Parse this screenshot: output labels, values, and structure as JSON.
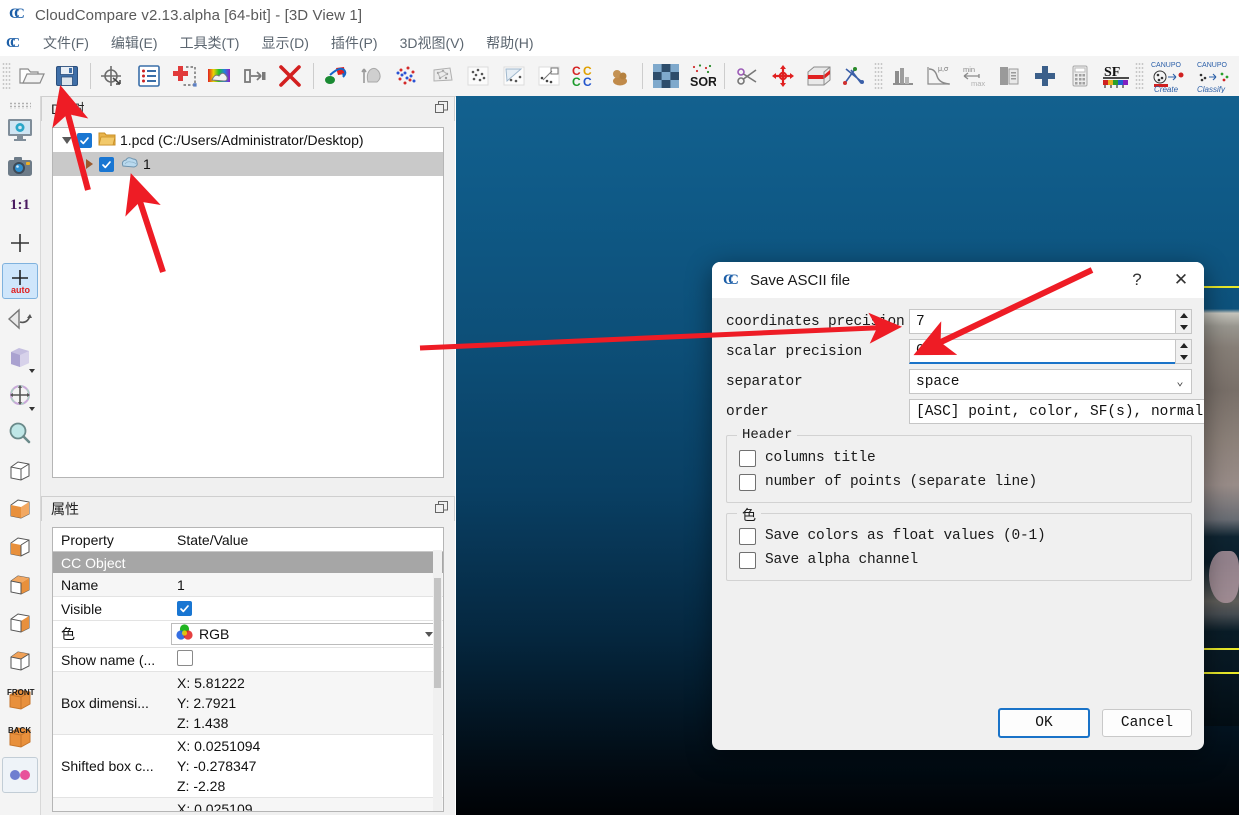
{
  "window": {
    "title": "CloudCompare v2.13.alpha [64-bit] - [3D View 1]",
    "app_icon": "cloudcompare-logo-icon"
  },
  "menubar": {
    "items": [
      {
        "label": "文件(F)",
        "name": "menu-file"
      },
      {
        "label": "编辑(E)",
        "name": "menu-edit"
      },
      {
        "label": "工具类(T)",
        "name": "menu-tools"
      },
      {
        "label": "显示(D)",
        "name": "menu-display"
      },
      {
        "label": "插件(P)",
        "name": "menu-plugins"
      },
      {
        "label": "3D视图(V)",
        "name": "menu-3dview"
      },
      {
        "label": "帮助(H)",
        "name": "menu-help"
      }
    ]
  },
  "toolbar": {
    "buttons": [
      {
        "icon": "open-folder-icon",
        "tip": "Open"
      },
      {
        "icon": "save-floppy-icon",
        "tip": "Save"
      },
      {
        "icon": "global-shift-icon",
        "tip": "Global shift settings"
      },
      {
        "icon": "properties-list-icon",
        "tip": "Toggle properties"
      },
      {
        "icon": "add-point-icon",
        "tip": "Clone"
      },
      {
        "icon": "colors-rainbow-icon",
        "tip": "Colors"
      },
      {
        "icon": "merge-icon",
        "tip": "Merge"
      },
      {
        "icon": "delete-cross-icon",
        "tip": "Delete"
      },
      {
        "icon": "registration-icon",
        "tip": "Register"
      },
      {
        "icon": "segment-gray-icon",
        "tip": "Segment"
      },
      {
        "icon": "sample-points-icon",
        "tip": "Sample points"
      },
      {
        "icon": "mesh-gray-icon",
        "tip": "Mesh"
      },
      {
        "icon": "scatter-gray-icon",
        "tip": "Compute cloud/cloud distance"
      },
      {
        "icon": "cloud-mesh-dist-icon",
        "tip": "Compute cloud/mesh distance"
      },
      {
        "icon": "cloud-prim-dist-icon",
        "tip": "Compute cloud/primitive distance"
      },
      {
        "icon": "cc-compare-icon",
        "tip": "Cloud/cloud compare"
      },
      {
        "icon": "statistical-test-icon",
        "tip": "Statistical test"
      },
      {
        "icon": "subsample-icon",
        "tip": "Subsample"
      },
      {
        "icon": "sor-filter-icon",
        "tip": "SOR filter"
      },
      {
        "icon": "scissors-icon",
        "tip": "Segment"
      },
      {
        "icon": "translate-rotate-icon",
        "tip": "Translate/Rotate"
      },
      {
        "icon": "cross-section-icon",
        "tip": "Cross section"
      },
      {
        "icon": "point-pair-align-icon",
        "tip": "Point pair based alignment"
      },
      {
        "icon": "histogram-icon",
        "tip": "Histogram"
      },
      {
        "icon": "gaussian-icon",
        "tip": "Compute stat. params"
      },
      {
        "icon": "minmax-icon",
        "tip": "SF min/max"
      },
      {
        "icon": "sf-delete-icon",
        "tip": "Delete scalar field"
      },
      {
        "icon": "sf-add-icon",
        "tip": "Add scalar field"
      },
      {
        "icon": "calculator-icon",
        "tip": "SF arithmetic"
      },
      {
        "icon": "sf-colorscale-icon",
        "tip": "Edit color scale"
      },
      {
        "icon": "canupo-create-icon",
        "label1": "CANUPO",
        "label2": "Create"
      },
      {
        "icon": "canupo-classify-icon",
        "label1": "CANUPO",
        "label2": "Classify"
      }
    ]
  },
  "left_toolbar": {
    "buttons": [
      {
        "icon": "display-settings-icon",
        "name": "lt-display-settings"
      },
      {
        "icon": "camera-snapshot-icon",
        "name": "lt-snapshot"
      },
      {
        "icon": "zoom-one-to-one-icon",
        "label": "1:1",
        "name": "lt-zoom-1-1"
      },
      {
        "icon": "pivot-center-icon",
        "name": "lt-set-pivot"
      },
      {
        "icon": "pivot-auto-icon",
        "label": "auto",
        "name": "lt-auto-pivot",
        "selected": true
      },
      {
        "icon": "viewport-rotate-icon",
        "name": "lt-rotate-viewport"
      },
      {
        "icon": "cube-shade-icon",
        "name": "lt-default-views",
        "has_dropdown": true
      },
      {
        "icon": "translate-gizmo-icon",
        "name": "lt-pick-rotation",
        "has_dropdown": true
      },
      {
        "icon": "zoom-magnifier-icon",
        "name": "lt-zoom-global"
      },
      {
        "icon": "view-top-icon",
        "name": "lt-view-top"
      },
      {
        "icon": "view-bottom-icon",
        "name": "lt-view-bottom"
      },
      {
        "icon": "view-left-icon",
        "name": "lt-view-left"
      },
      {
        "icon": "view-right-icon",
        "name": "lt-view-right"
      },
      {
        "icon": "view-iso1-icon",
        "name": "lt-view-iso1"
      },
      {
        "icon": "view-iso2-icon",
        "name": "lt-view-iso2"
      },
      {
        "icon": "view-front-icon",
        "label": "FRONT",
        "name": "lt-view-front"
      },
      {
        "icon": "view-back-icon",
        "label": "BACK",
        "name": "lt-view-back"
      },
      {
        "icon": "stereo-mode-icon",
        "name": "lt-stereo-mode"
      }
    ]
  },
  "db_dock": {
    "title": "DB树",
    "float_icon": "float-dock-icon",
    "tree": [
      {
        "label": "1.pcd (C:/Users/Administrator/Desktop)",
        "icon": "folder-icon",
        "checked": true,
        "expanded": true,
        "selected": false
      },
      {
        "label": "1",
        "icon": "point-cloud-icon",
        "checked": true,
        "expanded": false,
        "selected": true
      }
    ]
  },
  "props_dock": {
    "title": "属性",
    "float_icon": "float-dock-icon",
    "columns": [
      "Property",
      "State/Value"
    ],
    "section": "CC Object",
    "rows": [
      {
        "key": "Name",
        "value": "1",
        "type": "text"
      },
      {
        "key": "Visible",
        "value": "",
        "type": "checkbox-checked"
      },
      {
        "key": "色",
        "value": "RGB",
        "type": "combo",
        "icon": "rgb-colorwheel-icon"
      },
      {
        "key": "Show name (...",
        "value": "",
        "type": "checkbox-empty"
      },
      {
        "key": "Box dimensi...",
        "type": "xyz",
        "x": "X: 5.81222",
        "y": "Y: 2.7921",
        "z": "Z: 1.438"
      },
      {
        "key": "Shifted box c...",
        "type": "xyz",
        "x": "X: 0.0251094",
        "y": "Y: -0.278347",
        "z": "Z: -2.28"
      },
      {
        "key": "",
        "type": "xyz-partial",
        "x": "X: 0.025109"
      }
    ]
  },
  "dialog": {
    "icon": "cloudcompare-logo-icon",
    "title": "Save ASCII file",
    "help_label": "?",
    "close_label": "✕",
    "fields": [
      {
        "label": "coordinates precision",
        "value": "7",
        "type": "spinbox",
        "name": "coordinates-precision-spinbox"
      },
      {
        "label": "scalar precision",
        "value": "0",
        "type": "spinbox",
        "name": "scalar-precision-spinbox",
        "focused": true
      },
      {
        "label": "separator",
        "value": "space",
        "type": "combo",
        "name": "separator-combo"
      },
      {
        "label": "order",
        "value": "[ASC] point, color, SF(s), normal",
        "type": "combo",
        "name": "order-combo"
      }
    ],
    "groups": [
      {
        "title": "Header",
        "name": "header-group",
        "checkboxes": [
          {
            "label": "columns title",
            "checked": false,
            "name": "columns-title-checkbox"
          },
          {
            "label": "number of points (separate line)",
            "checked": false,
            "name": "number-of-points-checkbox"
          }
        ]
      },
      {
        "title": "色",
        "name": "color-group",
        "checkboxes": [
          {
            "label": "Save colors as float values (0-1)",
            "checked": false,
            "name": "save-colors-float-checkbox"
          },
          {
            "label": "Save alpha channel",
            "checked": false,
            "name": "save-alpha-channel-checkbox"
          }
        ]
      }
    ],
    "buttons": [
      {
        "label": "OK",
        "name": "ok-button",
        "default": true
      },
      {
        "label": "Cancel",
        "name": "cancel-button",
        "default": false
      }
    ]
  },
  "annotations": {
    "color": "#ee1c25",
    "arrows": [
      {
        "name": "arrow-to-db-tree-item"
      },
      {
        "name": "arrow-to-toolbar-save"
      },
      {
        "name": "arrow-to-coordinates-precision"
      },
      {
        "name": "arrow-to-scalar-precision"
      }
    ]
  },
  "colors": {
    "accent": "#1a73c8",
    "annotation_red": "#ee1c25",
    "dialog_bg": "#f0f0f0",
    "view_top": "#13618f",
    "view_bottom": "#000205",
    "selection_gray": "#c9c9c9",
    "section_gray": "#a6a6a6"
  }
}
